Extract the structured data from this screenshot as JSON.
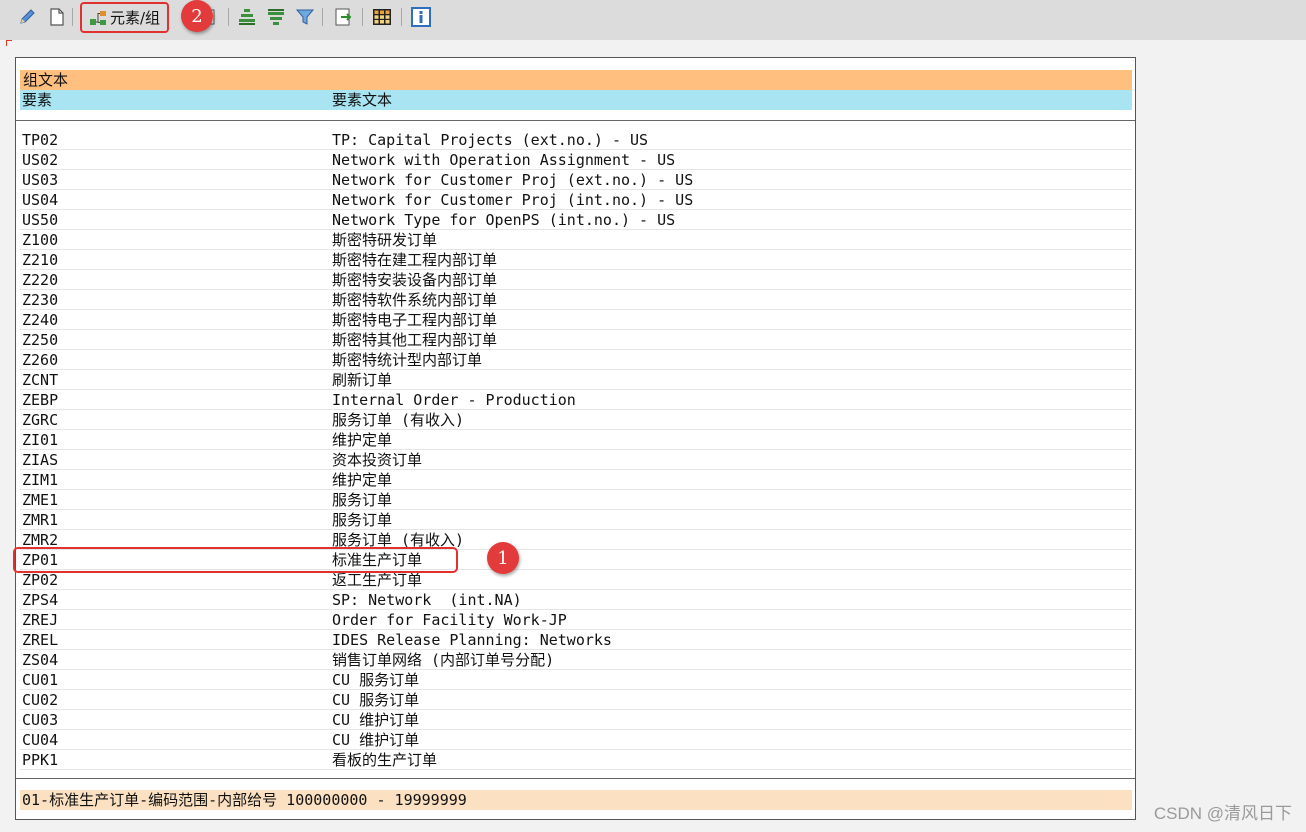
{
  "toolbar": {
    "elements_group_label": "元素/组",
    "icons": [
      "pencil-icon",
      "new-page-icon",
      "hierarchy-icon",
      "details-icon",
      "sort-ascending-icon",
      "sort-descending-icon",
      "filter-icon",
      "export-icon",
      "layout-grid-icon",
      "info-icon"
    ]
  },
  "annotations": {
    "badge_1": "1",
    "badge_2": "2"
  },
  "table": {
    "group_header": "组文本",
    "col_element": "要素",
    "col_element_text": "要素文本",
    "rows": [
      {
        "code": "TP02",
        "text": "TP: Capital Projects (ext.no.) - US"
      },
      {
        "code": "US02",
        "text": "Network with Operation Assignment - US"
      },
      {
        "code": "US03",
        "text": "Network for Customer Proj (ext.no.) - US"
      },
      {
        "code": "US04",
        "text": "Network for Customer Proj (int.no.) - US"
      },
      {
        "code": "US50",
        "text": "Network Type for OpenPS (int.no.) - US"
      },
      {
        "code": "Z100",
        "text": "斯密特研发订单"
      },
      {
        "code": "Z210",
        "text": "斯密特在建工程内部订单"
      },
      {
        "code": "Z220",
        "text": "斯密特安装设备内部订单"
      },
      {
        "code": "Z230",
        "text": "斯密特软件系统内部订单"
      },
      {
        "code": "Z240",
        "text": "斯密特电子工程内部订单"
      },
      {
        "code": "Z250",
        "text": "斯密特其他工程内部订单"
      },
      {
        "code": "Z260",
        "text": "斯密特统计型内部订单"
      },
      {
        "code": "ZCNT",
        "text": "刷新订单"
      },
      {
        "code": "ZEBP",
        "text": "Internal Order - Production"
      },
      {
        "code": "ZGRC",
        "text": "服务订单 (有收入)"
      },
      {
        "code": "ZI01",
        "text": "维护定单"
      },
      {
        "code": "ZIAS",
        "text": "资本投资订单"
      },
      {
        "code": "ZIM1",
        "text": "维护定单"
      },
      {
        "code": "ZME1",
        "text": "服务订单"
      },
      {
        "code": "ZMR1",
        "text": "服务订单"
      },
      {
        "code": "ZMR2",
        "text": "服务订单 (有收入)"
      },
      {
        "code": "ZP01",
        "text": "标准生产订单"
      },
      {
        "code": "ZP02",
        "text": "返工生产订单"
      },
      {
        "code": "ZPS4",
        "text": "SP: Network  (int.NA)"
      },
      {
        "code": "ZREJ",
        "text": "Order for Facility Work-JP"
      },
      {
        "code": "ZREL",
        "text": "IDES Release Planning: Networks"
      },
      {
        "code": "ZS04",
        "text": "销售订单网络 (内部订单号分配)"
      },
      {
        "code": "CU01",
        "text": "CU 服务订单"
      },
      {
        "code": "CU02",
        "text": "CU 服务订单"
      },
      {
        "code": "CU03",
        "text": "CU 维护订单"
      },
      {
        "code": "CU04",
        "text": "CU 维护订单"
      },
      {
        "code": "PPK1",
        "text": "看板的生产订单"
      }
    ],
    "footer": "01-标准生产订单-编码范围-内部给号 100000000 - 19999999"
  },
  "watermark": "CSDN @清风日下",
  "colors": {
    "group_header_bg": "#ffbf7f",
    "column_header_bg": "#a8e4f2",
    "footer_bg": "#fbe1c2",
    "annotation_red": "#e0312f"
  }
}
